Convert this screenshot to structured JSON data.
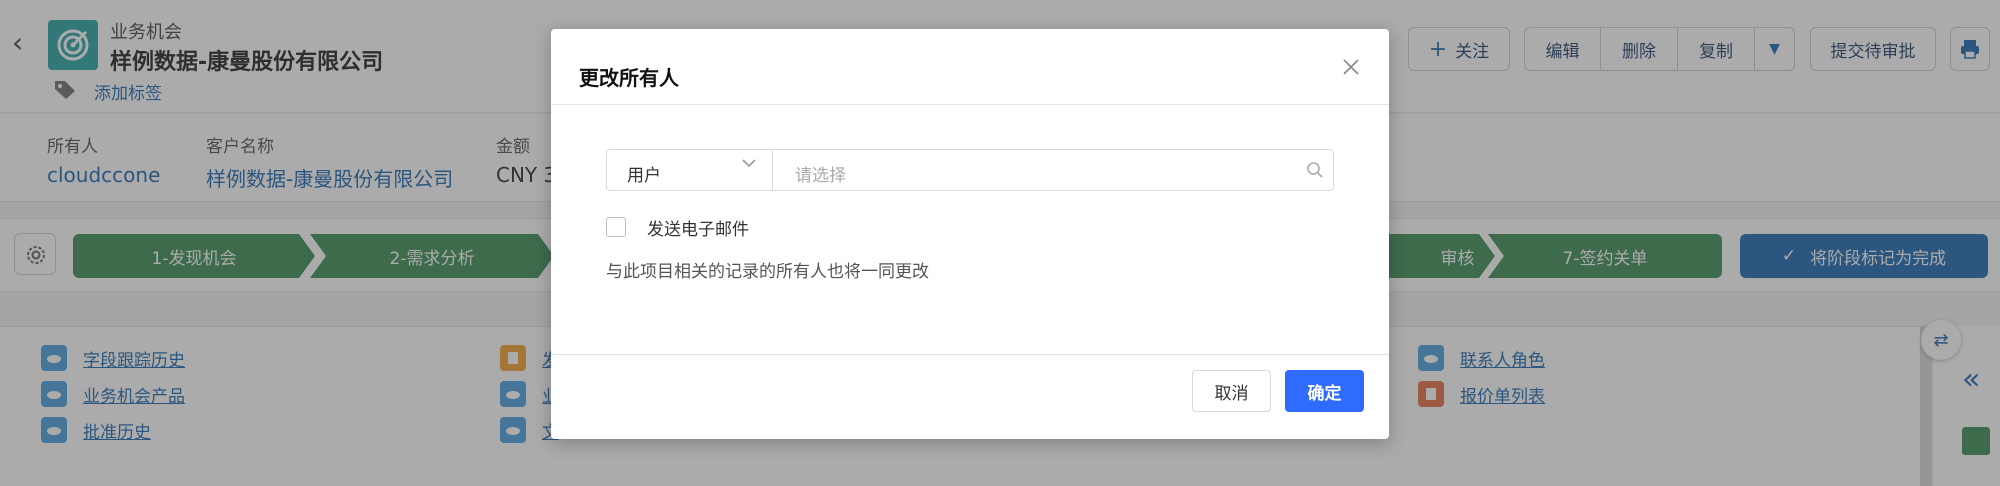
{
  "header": {
    "object_type": "业务机会",
    "record_name": "样例数据-康曼股份有限公司",
    "add_tag": "添加标签"
  },
  "actions": {
    "follow": "关注",
    "edit": "编辑",
    "delete": "删除",
    "copy": "复制",
    "submit_approval": "提交待审批"
  },
  "fields": [
    {
      "label": "所有人",
      "value": "cloudccone"
    },
    {
      "label": "客户名称",
      "value": "样例数据-康曼股份有限公司"
    },
    {
      "label": "金额",
      "value": "CNY 3"
    }
  ],
  "path": {
    "stages": [
      "1-发现机会",
      "2-需求分析",
      "审核",
      "7-签约关单"
    ],
    "complete_label": "将阶段标记为完成"
  },
  "related_lists": [
    "字段跟踪历史",
    "业务机会产品",
    "批准历史",
    "发",
    "业",
    "文",
    "联系人角色",
    "报价单列表"
  ],
  "modal": {
    "title": "更改所有人",
    "select_value": "用户",
    "search_placeholder": "请选择",
    "send_email_label": "发送电子邮件",
    "hint": "与此项目相关的记录的所有人也将一同更改",
    "cancel": "取消",
    "confirm": "确定"
  },
  "colors": {
    "accent": "#2f6bff",
    "path_green": "#2e844a",
    "brand_blue": "#0b5cab",
    "object_icon": "#1a9e9e"
  }
}
